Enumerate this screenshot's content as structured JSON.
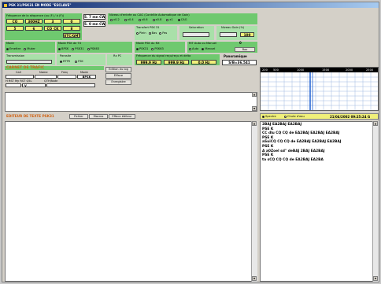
{
  "window": {
    "title": "PSK 31/PSK31 EN MODE \"ESCLAVE\""
  },
  "params": {
    "freq_label": "Fréquence de la séquence (ou (F) / à (F))",
    "values": [
      "CQ",
      "300HZ",
      "3",
      "0",
      "5",
      "6",
      "CQ_CK",
      "8",
      "UTC/GMT"
    ],
    "speed1": "5. 7 mn CW",
    "speed2": "5. 0 mn CW"
  },
  "cag": {
    "label": "Niveau d'entrée ou CAG (Contrôle Automatique de Gain)",
    "options": [
      "x0.2",
      "x0.4",
      "x0.6",
      "x0.8",
      "x1",
      "CAG"
    ],
    "selected": 5
  },
  "mode": {
    "label": "Mode",
    "options": [
      "Emettre",
      "Muter"
    ],
    "selected": 0
  },
  "mode_pc": {
    "label": "Mode PSK de TX",
    "options": [
      "BPSK",
      "PSK31",
      "PSK63"
    ],
    "selected": 0
  },
  "transfert": {
    "label": "Transfert PSK 31",
    "options": [
      "Plein",
      "Bas",
      "Pas"
    ]
  },
  "saturation": {
    "label": "Saturation"
  },
  "niveau": {
    "label": "Niveau Gain (%)",
    "value": "100"
  },
  "transmission": {
    "label": "Transmission"
  },
  "parasite": {
    "label": "Parasite",
    "options": [
      "RTTR",
      "FSK"
    ]
  },
  "rx_pc": {
    "label": "Rx PC"
  },
  "mode_rx": {
    "label": "Mode PSK du RX",
    "options": [
      "PSK31",
      "PSK63"
    ],
    "selected": 0
  },
  "rit": {
    "label": "RIT Auto ou Manuel",
    "options": [
      "Auto",
      "Manuel"
    ],
    "selected": 1,
    "value": "0",
    "button": "Raz"
  },
  "freq_signal": {
    "label": "Fréquence du signal reçu/reçu et delta",
    "values": [
      "999.9 Hz",
      "999.9 Hz",
      "0.0 Hz"
    ]
  },
  "panoramique": {
    "label": "Panoramique",
    "sn": "S/B=36.541"
  },
  "carnet": {
    "label": "CARNET DE TRAFIC",
    "cols": [
      "Call",
      "Name",
      "Freq",
      "Mode"
    ],
    "mode_value": "BPSK",
    "rst_label": "H RST My RST Q5L",
    "qth_label": "QTH/Note",
    "v_value": "V",
    "buttons": [
      "Edition du log",
      "Efface",
      "Enregistre"
    ]
  },
  "spectrum": {
    "axis": [
      "200",
      "500",
      "1000",
      "1500",
      "2000",
      "2500"
    ],
    "options": [
      "Spectre",
      "Chute d'eau"
    ],
    "selected": 0,
    "timestamp": "21/04/2002 09:25:24 G"
  },
  "editor": {
    "label": "EDITEUR DE TEXTE PSK31",
    "buttons": [
      "Fichier",
      "Macros",
      "Efface éditeur"
    ]
  },
  "rx_text": [
    "2BAJ EA2BAJ EA2BAJ",
    "PSE K",
    "CC dlu CQ CQ de EA2BAJ EA2BAJ EA2BAJ",
    "PSE K",
    "aSuiCQ CQ CQ de EA2BAJ EA2BAJ EA2BAJ",
    "PSE K",
    "A a0Zoel sd\" deBAJ 2BAJ EA2BAJ",
    "PSE K",
    "ta sCQ CQ CQ de EA2BAJ EA2BA"
  ]
}
